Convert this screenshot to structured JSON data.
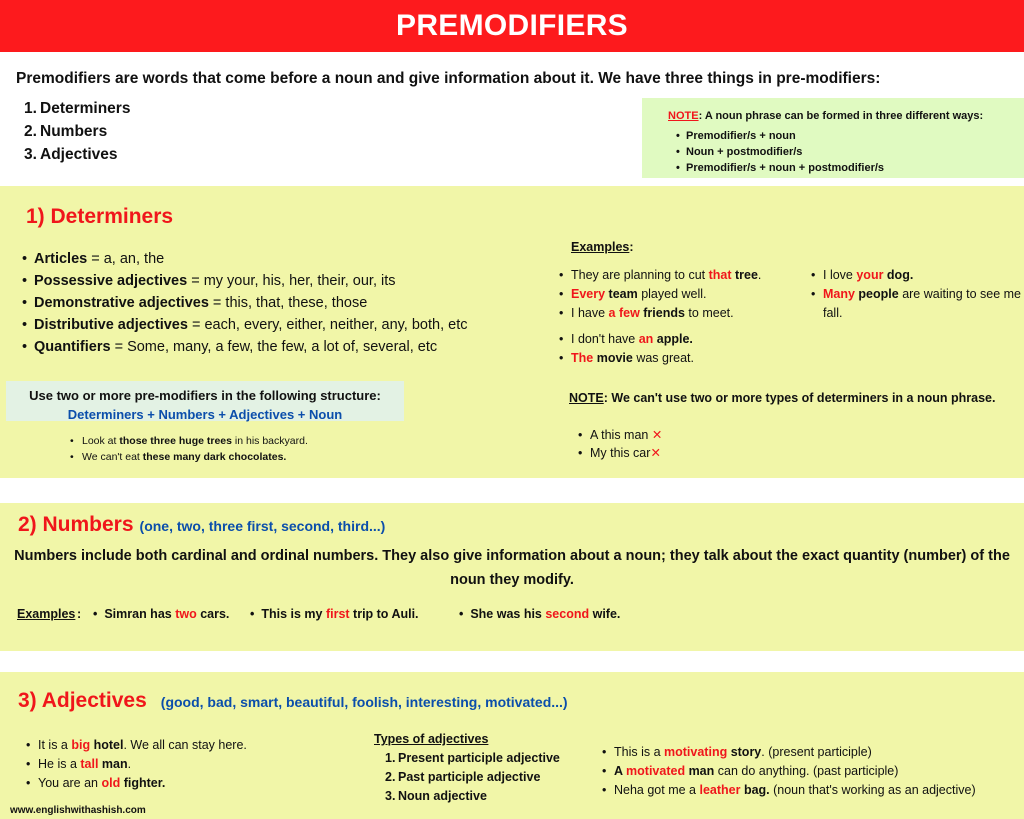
{
  "title": "PREMODIFIERS",
  "intro": {
    "text": "Premodifiers are words that come before a noun and give information about it. We have three things in pre-modifiers:",
    "items": [
      {
        "num": "1.",
        "label": "Determiners"
      },
      {
        "num": "2.",
        "label": "Numbers"
      },
      {
        "num": "3.",
        "label": "Adjectives"
      }
    ]
  },
  "note_box": {
    "label": "NOTE",
    "text": ": A noun phrase can be formed in three different ways:",
    "items": [
      "Premodifier/s + noun",
      "Noun + postmodifier/s",
      "Premodifier/s + noun + postmodifier/s"
    ]
  },
  "determiners": {
    "title": "1) Determiners",
    "types": [
      {
        "term": "Articles",
        "values": " = a, an, the"
      },
      {
        "term": "Possessive adjectives",
        "values": " = my your, his, her, their, our, its"
      },
      {
        "term": "Demonstrative adjectives",
        "values": " = this, that, these, those"
      },
      {
        "term": "Distributive adjectives",
        "values": " = each, every, either, neither, any, both, etc"
      },
      {
        "term": "Quantifiers",
        "values": " = Some, many, a few, the few, a lot of, several, etc"
      }
    ],
    "examples_label": "Examples",
    "examples_col1": [
      {
        "pre": "They are planning to cut ",
        "hl": "that",
        "noun": " tree",
        "post": "."
      },
      {
        "pre": "",
        "hl": "Every",
        "noun": " team",
        "post": " played well."
      },
      {
        "pre": "I have ",
        "hl": "a few",
        "noun": " friends",
        "post": " to meet."
      }
    ],
    "examples_col1b": [
      {
        "pre": "I don't have ",
        "hl": "an",
        "noun": " apple.",
        "post": ""
      },
      {
        "pre": "",
        "hl": "The",
        "noun": " movie",
        "post": " was great."
      }
    ],
    "examples_col2": [
      {
        "pre": "I love ",
        "hl": "your",
        "noun": " dog.",
        "post": ""
      },
      {
        "pre": "",
        "hl": "Many",
        "noun": " people",
        "post": " are waiting to see me fall."
      }
    ],
    "structure": {
      "line1": "Use two or more pre-modifiers in the following structure:",
      "line2": "Determiners + Numbers + Adjectives + Noun",
      "examples": [
        {
          "pre": "Look at ",
          "bold": "those three huge trees",
          "post": " in his backyard."
        },
        {
          "pre": "We can't eat ",
          "bold": "these many dark chocolates.",
          "post": ""
        }
      ]
    },
    "note": {
      "label": "NOTE",
      "text": ": We can't use two or more types of determiners in a noun phrase."
    },
    "wrong_examples": [
      {
        "text": "A this man ",
        "mark": "✕"
      },
      {
        "text": "My this car",
        "mark": "✕"
      }
    ]
  },
  "numbers": {
    "title": "2) Numbers",
    "subtitle": "(one, two, three first, second, third...)",
    "description": "Numbers include both cardinal and ordinal numbers. They also give information about a noun; they talk about the exact quantity (number) of the noun they modify.",
    "examples_label": "Examples",
    "examples": [
      {
        "pre": "Simran has ",
        "hl": "two",
        "post": " cars."
      },
      {
        "pre": "This is my ",
        "hl": "first",
        "post": " trip to Auli."
      },
      {
        "pre": "She was his ",
        "hl": "second",
        "post": " wife."
      }
    ]
  },
  "adjectives": {
    "title": "3) Adjectives",
    "subtitle": "(good, bad, smart, beautiful, foolish, interesting, motivated...)",
    "examples": [
      {
        "pre": "It is a ",
        "hl": "big",
        "noun": " hotel",
        "post": ". We all can stay here."
      },
      {
        "pre": "He is a ",
        "hl": "tall",
        "noun": " man",
        "post": "."
      },
      {
        "pre": "You are an ",
        "hl": "old",
        "noun": " fighter.",
        "post": ""
      }
    ],
    "types_label": "Types of adjectives",
    "types": [
      {
        "num": "1.",
        "label": "Present participle adjective"
      },
      {
        "num": "2.",
        "label": "Past participle adjective"
      },
      {
        "num": "3.",
        "label": "Noun adjective"
      }
    ],
    "type_examples": [
      {
        "pre": "This is a ",
        "hl": "motivating",
        "noun": " story",
        "post": ". (present participle)"
      },
      {
        "pre": "A ",
        "hl": "motivated",
        "noun": " man",
        "post": " can do anything. (past participle)"
      },
      {
        "pre": "Neha got me a ",
        "hl": "leather",
        "noun": " bag.",
        "post": " (noun that's working as an adjective)"
      }
    ]
  },
  "footer": {
    "website": "www.englishwithashish.com"
  }
}
